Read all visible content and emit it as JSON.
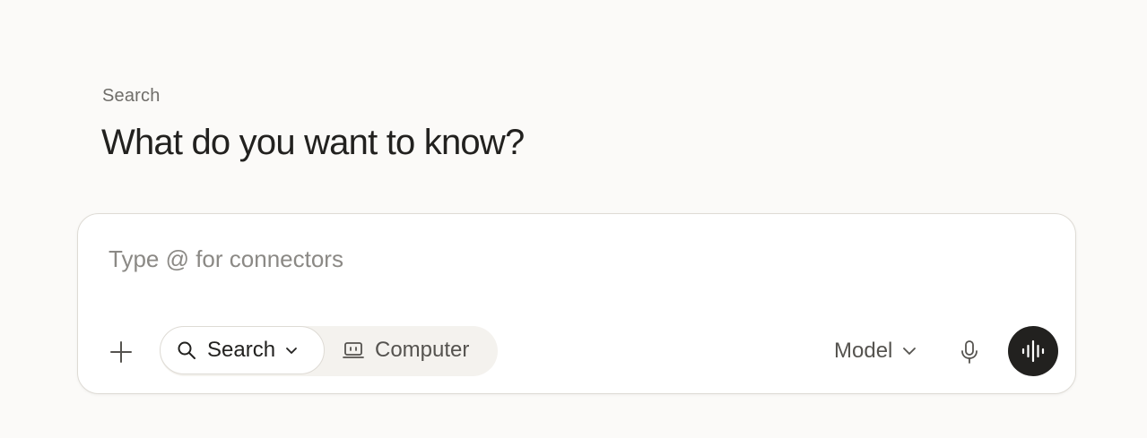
{
  "header": {
    "eyebrow": "Search",
    "title": "What do you want to know?"
  },
  "composer": {
    "value": "",
    "placeholder": "Type @ for connectors",
    "attach_icon": "plus-icon",
    "modes": [
      {
        "label": "Search",
        "icon": "search-icon",
        "selected": true,
        "has_dropdown": true
      },
      {
        "label": "Computer",
        "icon": "computer-icon",
        "selected": false,
        "has_dropdown": false
      }
    ],
    "model_label": "Model",
    "mic_icon": "microphone-icon",
    "voice_icon": "voice-waveform-icon"
  },
  "colors": {
    "background": "#fbfaf8",
    "surface": "#ffffff",
    "border": "#dedbd5",
    "text_primary": "#22211f",
    "text_secondary": "#6f6d69",
    "voice_button": "#22211f"
  }
}
